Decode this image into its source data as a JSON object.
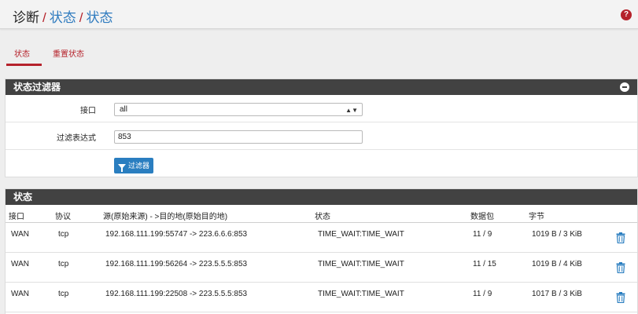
{
  "header": {
    "crumb_root": "诊断",
    "crumb_sep": "/",
    "crumb_2": "状态",
    "crumb_3": "状态",
    "help": "?"
  },
  "tabs": [
    {
      "label": "状态",
      "active": true
    },
    {
      "label": "重置状态",
      "active": false
    }
  ],
  "filter": {
    "title": "状态过滤器",
    "interface_label": "接口",
    "interface_value": "all",
    "expression_label": "过滤表达式",
    "expression_value": "853",
    "button_label": "过滤器"
  },
  "states": {
    "title": "状态",
    "columns": [
      "接口",
      "协议",
      "源(原始来源) - >目的地(原始目的地)",
      "状态",
      "数据包",
      "字节"
    ],
    "rows": [
      {
        "iface": "WAN",
        "proto": "tcp",
        "srcdst": "192.168.111.199:55747 -> 223.6.6.6:853",
        "state": "TIME_WAIT:TIME_WAIT",
        "packets": "11 / 9",
        "bytes": "1019 B / 3 KiB"
      },
      {
        "iface": "WAN",
        "proto": "tcp",
        "srcdst": "192.168.111.199:56264 -> 223.5.5.5:853",
        "state": "TIME_WAIT:TIME_WAIT",
        "packets": "11 / 15",
        "bytes": "1019 B / 4 KiB"
      },
      {
        "iface": "WAN",
        "proto": "tcp",
        "srcdst": "192.168.111.199:22508 -> 223.5.5.5:853",
        "state": "TIME_WAIT:TIME_WAIT",
        "packets": "11 / 9",
        "bytes": "1017 B / 3 KiB"
      }
    ]
  },
  "colors": {
    "accent": "#b5222b",
    "link": "#2f7bbf",
    "button": "#2a7ec0",
    "panel_head": "#424242"
  }
}
